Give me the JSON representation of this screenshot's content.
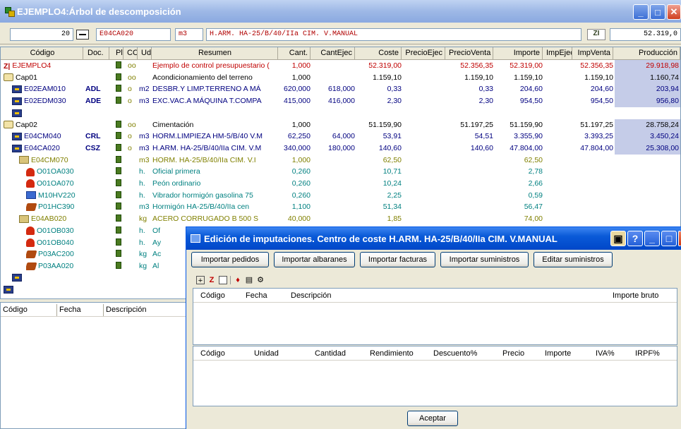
{
  "window": {
    "title": "EJEMPLO4:Árbol de descomposición"
  },
  "toolbar": {
    "count": "20",
    "code": "E04CA020",
    "unit": "m3",
    "summary": "H.ARM. HA-25/B/40/IIa CIM. V.MANUAL",
    "amount": "52.319,0"
  },
  "grid": {
    "columns": [
      "Código",
      "Doc.",
      "Pli",
      "CC",
      "Ud",
      "Resumen",
      "Cant.",
      "CantEjec",
      "Coste",
      "PrecioEjec",
      "PrecioVenta",
      "Importe",
      "ImpEjec",
      "ImpVenta",
      "Producción"
    ],
    "rows": [
      {
        "icon": "root-icon",
        "code": "EJEMPLO4",
        "doc": "",
        "ud": "",
        "summary": "Ejemplo de control presupuestario (",
        "cant": "1,000",
        "cantejec": "",
        "coste": "52.319,00",
        "precioejec": "",
        "precioventa": "52.356,35",
        "importe": "52.319,00",
        "impejec": "",
        "impventa": "52.356,35",
        "produccion": "29.918,98",
        "color": "#c00000",
        "marks": "oo"
      },
      {
        "icon": "folder-icon",
        "code": "Cap01",
        "doc": "",
        "ud": "",
        "summary": "Acondicionamiento del terreno",
        "cant": "1,000",
        "cantejec": "",
        "coste": "1.159,10",
        "precioejec": "",
        "precioventa": "1.159,10",
        "importe": "1.159,10",
        "impejec": "",
        "impventa": "1.159,10",
        "produccion": "1.160,74",
        "color": "#000000",
        "marks": "oo"
      },
      {
        "icon": "task-icon",
        "code": "E02EAM010",
        "doc": "ADL",
        "ud": "m2",
        "summary": "DESBR.Y LIMP.TERRENO A MÁ",
        "cant": "620,000",
        "cantejec": "618,000",
        "coste": "0,33",
        "precioejec": "",
        "precioventa": "0,33",
        "importe": "204,60",
        "impejec": "",
        "impventa": "204,60",
        "produccion": "203,94",
        "color": "#000080",
        "marks": "o"
      },
      {
        "icon": "task-icon",
        "code": "E02EDM030",
        "doc": "ADE",
        "ud": "m3",
        "summary": "EXC.VAC.A MÁQUINA T.COMPA",
        "cant": "415,000",
        "cantejec": "416,000",
        "coste": "2,30",
        "precioejec": "",
        "precioventa": "2,30",
        "importe": "954,50",
        "impejec": "",
        "impventa": "954,50",
        "produccion": "956,80",
        "color": "#000080",
        "marks": "o"
      },
      {
        "icon": "empty-icon",
        "code": "",
        "doc": "",
        "ud": "",
        "summary": "",
        "cant": "",
        "cantejec": "",
        "coste": "",
        "precioejec": "",
        "precioventa": "",
        "importe": "",
        "impejec": "",
        "impventa": "",
        "produccion": "",
        "color": "#000000",
        "marks": ""
      },
      {
        "icon": "folder-icon",
        "code": "Cap02",
        "doc": "",
        "ud": "",
        "summary": "Cimentación",
        "cant": "1,000",
        "cantejec": "",
        "coste": "51.159,90",
        "precioejec": "",
        "precioventa": "51.197,25",
        "importe": "51.159,90",
        "impejec": "",
        "impventa": "51.197,25",
        "produccion": "28.758,24",
        "color": "#000000",
        "marks": "oo"
      },
      {
        "icon": "task-icon",
        "code": "E04CM040",
        "doc": "CRL",
        "ud": "m3",
        "summary": "HORM.LIMPIEZA HM-5/B/40 V.M",
        "cant": "62,250",
        "cantejec": "64,000",
        "coste": "53,91",
        "precioejec": "",
        "precioventa": "54,51",
        "importe": "3.355,90",
        "impejec": "",
        "impventa": "3.393,25",
        "produccion": "3.450,24",
        "color": "#000080",
        "marks": "o"
      },
      {
        "icon": "task-icon",
        "code": "E04CA020",
        "doc": "CSZ",
        "ud": "m3",
        "summary": "H.ARM. HA-25/B/40/IIa CIM. V.M",
        "cant": "340,000",
        "cantejec": "180,000",
        "coste": "140,60",
        "precioejec": "",
        "precioventa": "140,60",
        "importe": "47.804,00",
        "impejec": "",
        "impventa": "47.804,00",
        "produccion": "25.308,00",
        "color": "#000080",
        "marks": "o"
      },
      {
        "icon": "aux-icon",
        "code": "E04CM070",
        "doc": "",
        "ud": "m3",
        "summary": "HORM. HA-25/B/40/IIa CIM. V.I",
        "cant": "1,000",
        "cantejec": "",
        "coste": "62,50",
        "precioejec": "",
        "precioventa": "",
        "importe": "62,50",
        "impejec": "",
        "impventa": "",
        "produccion": "",
        "color": "#808000",
        "marks": ""
      },
      {
        "icon": "worker-icon",
        "code": "O01OA030",
        "doc": "",
        "ud": "h.",
        "summary": "Oficial primera",
        "cant": "0,260",
        "cantejec": "",
        "coste": "10,71",
        "precioejec": "",
        "precioventa": "",
        "importe": "2,78",
        "impejec": "",
        "impventa": "",
        "produccion": "",
        "color": "#008080",
        "marks": ""
      },
      {
        "icon": "worker-icon",
        "code": "O01OA070",
        "doc": "",
        "ud": "h.",
        "summary": "Peón ordinario",
        "cant": "0,260",
        "cantejec": "",
        "coste": "10,24",
        "precioejec": "",
        "precioventa": "",
        "importe": "2,66",
        "impejec": "",
        "impventa": "",
        "produccion": "",
        "color": "#008080",
        "marks": ""
      },
      {
        "icon": "machine-icon",
        "code": "M10HV220",
        "doc": "",
        "ud": "h.",
        "summary": "Vibrador hormigón gasolina 75",
        "cant": "0,260",
        "cantejec": "",
        "coste": "2,25",
        "precioejec": "",
        "precioventa": "",
        "importe": "0,59",
        "impejec": "",
        "impventa": "",
        "produccion": "",
        "color": "#008080",
        "marks": ""
      },
      {
        "icon": "material-icon",
        "code": "P01HC390",
        "doc": "",
        "ud": "m3",
        "summary": "Hormigón HA-25/B/40/IIa cen",
        "cant": "1,100",
        "cantejec": "",
        "coste": "51,34",
        "precioejec": "",
        "precioventa": "",
        "importe": "56,47",
        "impejec": "",
        "impventa": "",
        "produccion": "",
        "color": "#008080",
        "marks": ""
      },
      {
        "icon": "aux-icon",
        "code": "E04AB020",
        "doc": "",
        "ud": "kg",
        "summary": "ACERO CORRUGADO B 500 S",
        "cant": "40,000",
        "cantejec": "",
        "coste": "1,85",
        "precioejec": "",
        "precioventa": "",
        "importe": "74,00",
        "impejec": "",
        "impventa": "",
        "produccion": "",
        "color": "#808000",
        "marks": ""
      },
      {
        "icon": "worker-icon",
        "code": "O01OB030",
        "doc": "",
        "ud": "h.",
        "summary": "Of",
        "cant": "",
        "cantejec": "",
        "coste": "",
        "precioejec": "",
        "precioventa": "",
        "importe": "",
        "impejec": "",
        "impventa": "",
        "produccion": "",
        "color": "#008080",
        "marks": ""
      },
      {
        "icon": "worker-icon",
        "code": "O01OB040",
        "doc": "",
        "ud": "h.",
        "summary": "Ay",
        "cant": "",
        "cantejec": "",
        "coste": "",
        "precioejec": "",
        "precioventa": "",
        "importe": "",
        "impejec": "",
        "impventa": "",
        "produccion": "",
        "color": "#008080",
        "marks": ""
      },
      {
        "icon": "material-icon",
        "code": "P03AC200",
        "doc": "",
        "ud": "kg",
        "summary": "Ac",
        "cant": "",
        "cantejec": "",
        "coste": "",
        "precioejec": "",
        "precioventa": "",
        "importe": "",
        "impejec": "",
        "impventa": "",
        "produccion": "",
        "color": "#008080",
        "marks": ""
      },
      {
        "icon": "material-icon",
        "code": "P03AA020",
        "doc": "",
        "ud": "kg",
        "summary": "Al",
        "cant": "",
        "cantejec": "",
        "coste": "",
        "precioejec": "",
        "precioventa": "",
        "importe": "",
        "impejec": "",
        "impventa": "",
        "produccion": "",
        "color": "#008080",
        "marks": ""
      },
      {
        "icon": "empty-icon",
        "code": "",
        "doc": "",
        "ud": "",
        "summary": "",
        "cant": "",
        "cantejec": "",
        "coste": "",
        "precioejec": "",
        "precioventa": "",
        "importe": "",
        "impejec": "",
        "impventa": "",
        "produccion": "",
        "color": "#000000",
        "marks": ""
      },
      {
        "icon": "empty-icon",
        "code": "",
        "doc": "",
        "ud": "",
        "summary": "",
        "cant": "",
        "cantejec": "",
        "coste": "",
        "precioejec": "",
        "precioventa": "",
        "importe": "",
        "impejec": "",
        "impventa": "",
        "produccion": "",
        "color": "#000000",
        "marks": ""
      }
    ]
  },
  "lower": {
    "columns": [
      "Código",
      "Fecha",
      "Descripción"
    ]
  },
  "dialog": {
    "title": "Edición de imputaciones. Centro de coste H.ARM. HA-25/B/40/IIa CIM. V.MANUAL",
    "buttons": [
      "Importar pedidos",
      "Importar albaranes",
      "Importar facturas",
      "Importar suministros",
      "Editar suministros"
    ],
    "top_columns": [
      "Código",
      "Fecha",
      "Descripción",
      "Importe bruto"
    ],
    "bottom_columns": [
      "Código",
      "Unidad",
      "Cantidad",
      "Rendimiento",
      "Descuento%",
      "Precio",
      "Importe",
      "IVA%",
      "IRPF%"
    ],
    "accept": "Aceptar"
  }
}
